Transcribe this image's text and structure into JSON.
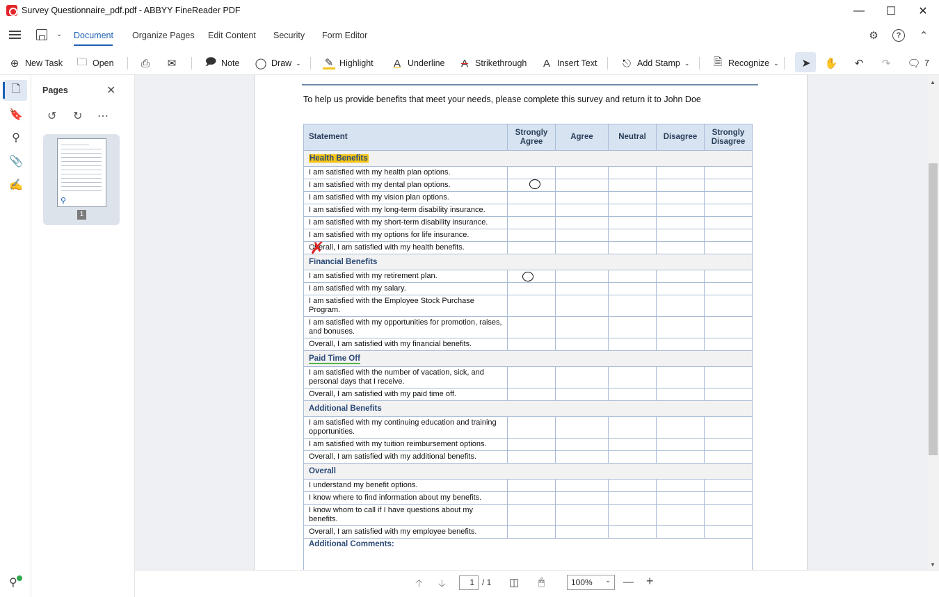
{
  "window": {
    "title": "Survey Questionnaire_pdf.pdf - ABBYY FineReader PDF"
  },
  "menu": {
    "tabs": [
      "Document",
      "Organize Pages",
      "Edit Content",
      "Security",
      "Form Editor"
    ],
    "active": "Document"
  },
  "toolbar": {
    "new_task": "New Task",
    "open": "Open",
    "note": "Note",
    "draw": "Draw",
    "highlight": "Highlight",
    "underline": "Underline",
    "strikethrough": "Strikethrough",
    "insert_text": "Insert Text",
    "add_stamp": "Add Stamp",
    "recognize": "Recognize",
    "comments_count": "7"
  },
  "pages_panel": {
    "title": "Pages",
    "page_number": "1"
  },
  "document": {
    "intro": "To help us provide benefits that meet your needs, please complete this survey and return it to John Doe",
    "columns": [
      "Statement",
      "Strongly Agree",
      "Agree",
      "Neutral",
      "Disagree",
      "Strongly Disagree"
    ],
    "sections": [
      {
        "title": "Health Benefits",
        "rows": [
          "I am satisfied with my health plan options.",
          "I am satisfied with my dental plan options.",
          "I am satisfied with my vision plan options.",
          "I am satisfied with my long-term disability insurance.",
          "I am satisfied with my short-term disability insurance.",
          "I am satisfied with my options for life insurance.",
          "Overall, I am satisfied with my health benefits."
        ]
      },
      {
        "title": "Financial Benefits",
        "rows": [
          "I am satisfied with my retirement plan.",
          "I am satisfied with my salary.",
          "I am satisfied with the Employee Stock Purchase Program.",
          "I am satisfied with my opportunities for promotion, raises, and bonuses.",
          "Overall, I am satisfied with my financial benefits."
        ]
      },
      {
        "title": "Paid Time Off",
        "rows": [
          "I am satisfied with the number of vacation, sick, and personal days that I receive.",
          "Overall, I am satisfied with my paid time off."
        ]
      },
      {
        "title": "Additional Benefits",
        "rows": [
          "I am satisfied with my continuing education and training opportunities.",
          "I am satisfied with my tuition reimbursement options.",
          "Overall, I am satisfied with my additional benefits."
        ]
      },
      {
        "title": "Overall",
        "rows": [
          "I understand my benefit options.",
          "I know where to find information about my benefits.",
          "I know whom to call if I have questions about my benefits.",
          "Overall, I am satisfied with my employee benefits."
        ]
      }
    ],
    "additional_comments": "Additional Comments:"
  },
  "status": {
    "current_page": "1",
    "total_pages": "/ 1",
    "zoom": "100%"
  }
}
